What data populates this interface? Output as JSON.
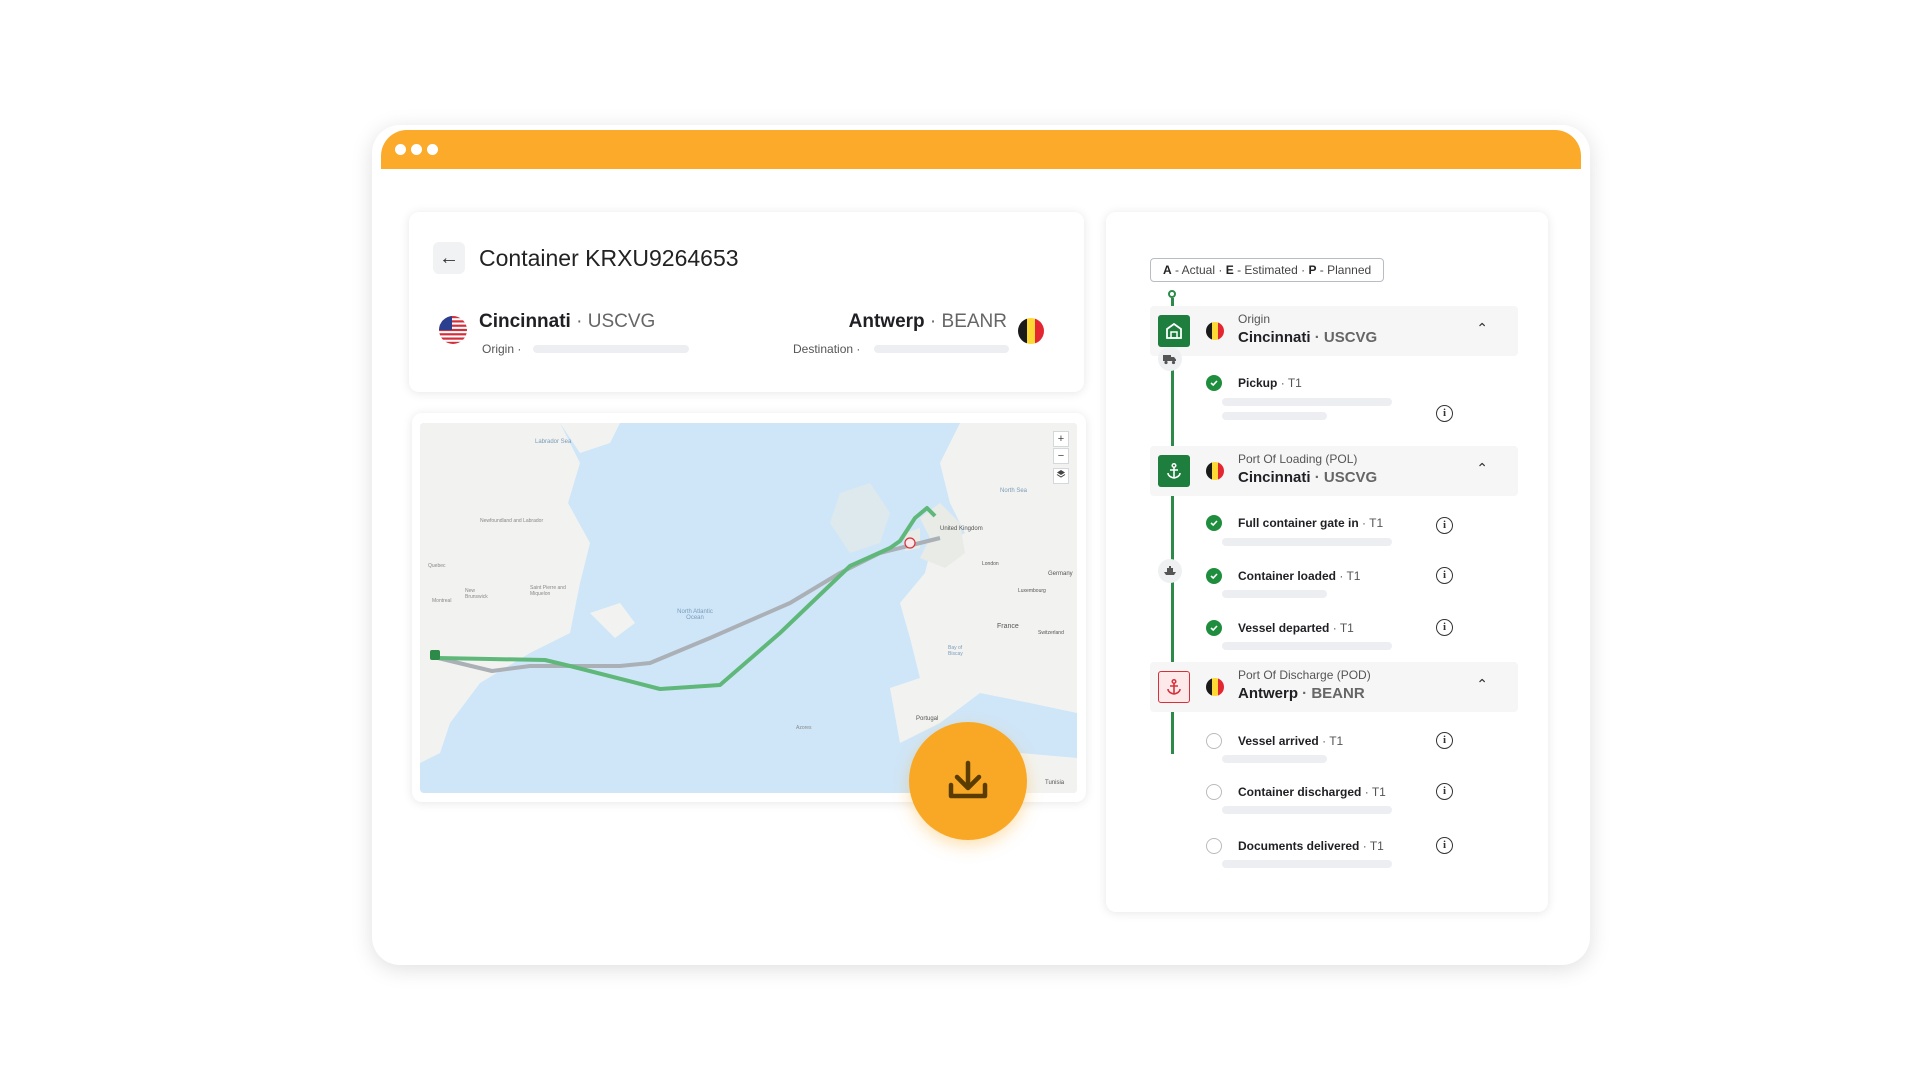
{
  "container": {
    "title": "Container KRXU9264653",
    "origin": {
      "city": "Cincinnati",
      "code": "USCVG",
      "label": "Origin ·"
    },
    "destination": {
      "city": "Antwerp",
      "code": "BEANR",
      "label": "Destination ·"
    }
  },
  "legend": {
    "a_key": "A",
    "a_text": " - Actual",
    "e_key": "E",
    "e_text": " - Estimated",
    "p_key": "P",
    "p_text": " - Planned",
    "sep": "·"
  },
  "map": {
    "labels": {
      "labrador_sea": "Labrador Sea",
      "newfoundland": "Newfoundland and Labrador",
      "quebec": "Quebec",
      "new_brunswick": "New Brunswick",
      "saint_pierre": "Saint Pierre and Miquelon",
      "north_atlantic": "North Atlantic Ocean",
      "north_sea": "North Sea",
      "united_kingdom": "United Kingdom",
      "london": "London",
      "germany": "Germany",
      "luxembourg": "Luxembourg",
      "france": "France",
      "switzerland": "Switzerland",
      "bay_of_biscay": "Bay of Biscay",
      "portugal": "Portugal",
      "tunisia": "Tunisia",
      "azores": "Azores",
      "montreal": "Montreal"
    },
    "zoom_in": "+",
    "zoom_out": "−",
    "colors": {
      "water": "#cfe6f8",
      "land": "#f2f3f0",
      "actual_route": "#5fb87a",
      "planned_route": "#aab0b6"
    }
  },
  "timeline": {
    "stages": [
      {
        "label": "Origin",
        "city": "Cincinnati",
        "code": "USCVG",
        "icon": "warehouse-icon",
        "variant": "green"
      },
      {
        "label": "Port Of Loading (POL)",
        "city": "Cincinnati",
        "code": "USCVG",
        "icon": "anchor-icon",
        "variant": "green"
      },
      {
        "label": "Port Of Discharge (POD)",
        "city": "Antwerp",
        "code": "BEANR",
        "icon": "anchor-icon",
        "variant": "red"
      }
    ],
    "events": [
      {
        "name": "Pickup",
        "terminal": "· T1",
        "done": true
      },
      {
        "name": "Full container gate in",
        "terminal": "· T1",
        "done": true
      },
      {
        "name": "Container loaded",
        "terminal": "· T1",
        "done": true
      },
      {
        "name": "Vessel departed",
        "terminal": "· T1",
        "done": true
      },
      {
        "name": "Vessel arrived",
        "terminal": "· T1",
        "done": false
      },
      {
        "name": "Container discharged",
        "terminal": "· T1",
        "done": false
      },
      {
        "name": "Documents delivered",
        "terminal": "· T1",
        "done": false
      }
    ]
  },
  "sep_dot": "·",
  "info_glyph": "i",
  "chevron_glyph": "⌃",
  "back_glyph": "←",
  "colors": {
    "brand": "#fbab29",
    "download": "#f9a825",
    "success": "#1e8e3e",
    "timeline": "#2e8a48",
    "alert": "#d6303b"
  }
}
